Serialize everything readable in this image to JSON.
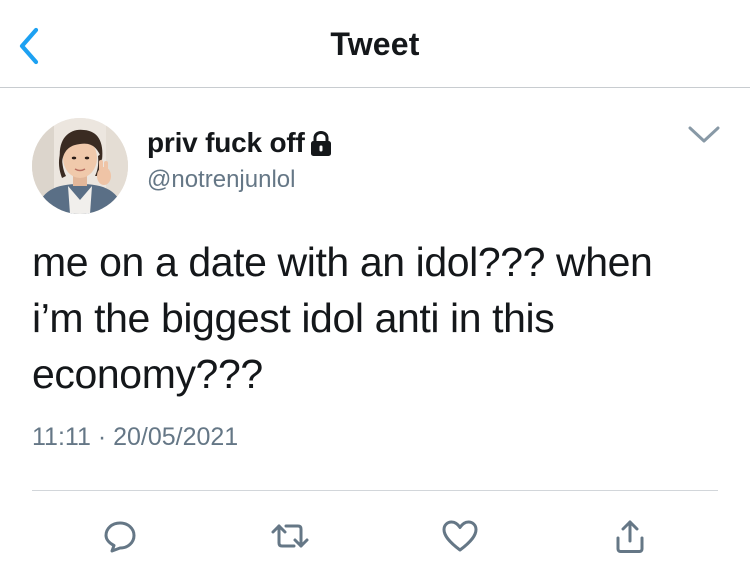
{
  "header": {
    "title": "Tweet",
    "back_icon": "chevron-left-icon",
    "accent_color": "#1da1f2"
  },
  "tweet": {
    "display_name": "priv fuck off",
    "handle": "@notrenjunlol",
    "protected_icon": "lock-icon",
    "text_lines": [
      "me on a date with an idol??? when",
      "i’m the biggest idol anti in this",
      "economy???"
    ],
    "time": "11:11",
    "separator": "·",
    "date": "20/05/2021"
  },
  "actions": [
    {
      "name": "reply",
      "icon": "reply-bubble-icon"
    },
    {
      "name": "retweet",
      "icon": "retweet-icon"
    },
    {
      "name": "like",
      "icon": "heart-icon"
    },
    {
      "name": "share",
      "icon": "share-icon"
    }
  ],
  "colors": {
    "text": "#14171a",
    "secondary": "#657786",
    "divider": "#d2d6da",
    "icon": "#657786"
  }
}
